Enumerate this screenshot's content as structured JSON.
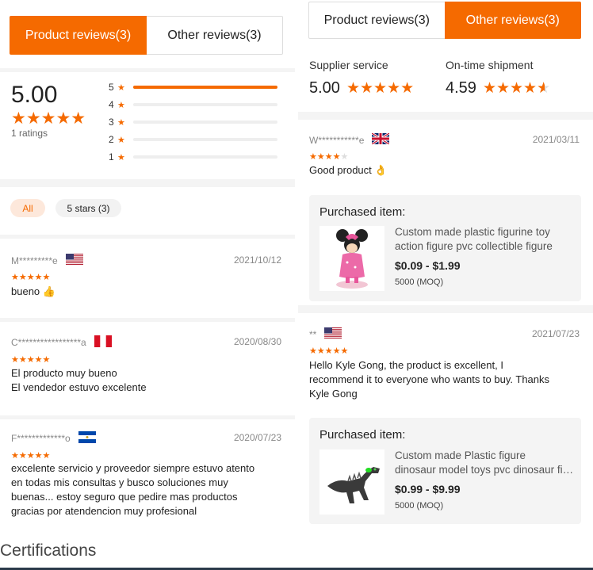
{
  "left": {
    "tabs": [
      {
        "label": "Product reviews(3)",
        "active": true
      },
      {
        "label": "Other reviews(3)",
        "active": false
      }
    ],
    "summary": {
      "score": "5.00",
      "stars": "★★★★★",
      "ratings_count": "1 ratings",
      "distribution": [
        {
          "label": "5",
          "fraction": 1.0
        },
        {
          "label": "4",
          "fraction": 0.0
        },
        {
          "label": "3",
          "fraction": 0.0
        },
        {
          "label": "2",
          "fraction": 0.0
        },
        {
          "label": "1",
          "fraction": 0.0
        }
      ]
    },
    "filters": [
      {
        "label": "All",
        "active": true
      },
      {
        "label": "5 stars (3)",
        "active": false
      }
    ],
    "reviews": [
      {
        "name": "M*********e",
        "flag": "us",
        "date": "2021/10/12",
        "stars": "★★★★★",
        "text": [
          "bueno 👍"
        ]
      },
      {
        "name": "C*****************a",
        "flag": "pe",
        "date": "2020/08/30",
        "stars": "★★★★★",
        "text": [
          "El producto muy bueno",
          "El vendedor estuvo excelente"
        ]
      },
      {
        "name": "F*************o",
        "flag": "sv",
        "date": "2020/07/23",
        "stars": "★★★★★",
        "text": [
          "excelente servicio y proveedor siempre estuvo atento",
          "en todas mis consultas y busco soluciones muy",
          "buenas... estoy seguro que pedire mas productos",
          "gracias por atendencion muy profesional"
        ]
      }
    ]
  },
  "right": {
    "tabs": [
      {
        "label": "Product reviews(3)",
        "active": false
      },
      {
        "label": "Other reviews(3)",
        "active": true
      }
    ],
    "metrics": [
      {
        "label": "Supplier service",
        "value": "5.00",
        "stars": "★★★★★"
      },
      {
        "label": "On-time shipment",
        "value": "4.59",
        "stars": "★★★★",
        "partial": 0.59
      }
    ],
    "reviews": [
      {
        "name": "W***********e",
        "flag": "gb",
        "date": "2021/03/11",
        "stars": "★★★★",
        "text": [
          "Good product 👌"
        ],
        "item": {
          "title": "Purchased item:",
          "name": [
            "Custom made plastic figurine toy",
            "action figure pvc collectible figure"
          ],
          "price": "$0.09 - $1.99",
          "moq": "5000 (MOQ)"
        }
      },
      {
        "name": "**",
        "flag": "us",
        "date": "2021/07/23",
        "stars": "★★★★★",
        "text": [
          "Hello Kyle Gong, the product is excellent, I",
          "recommend it to everyone who wants to buy. Thanks",
          "Kyle Gong"
        ],
        "item": {
          "title": "Purchased item:",
          "name": [
            "Custom made Plastic figure",
            "dinosaur model toys pvc dinosaur figure"
          ],
          "price": "$0.99 - $9.99",
          "moq": "5000 (MOQ)"
        }
      }
    ]
  },
  "certifications_title": "Certifications",
  "colors": {
    "accent": "#f56a00",
    "divider": "#f4f4f4"
  }
}
